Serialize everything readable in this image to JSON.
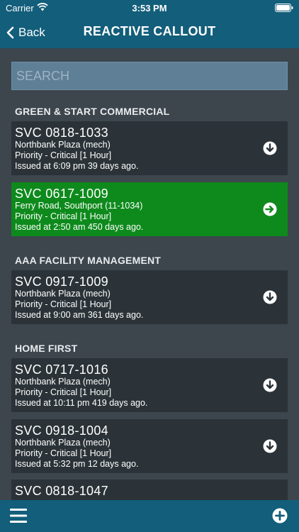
{
  "status_bar": {
    "carrier": "Carrier",
    "time": "3:53 PM"
  },
  "nav": {
    "back_label": "Back",
    "title": "REACTIVE CALLOUT"
  },
  "search": {
    "placeholder": "SEARCH",
    "value": ""
  },
  "sections": [
    {
      "name": "GREEN  & START COMMERCIAL",
      "items": [
        {
          "id": "SVC 0818-1033",
          "location": "Northbank Plaza (mech)",
          "priority": "Priority - Critical [1 Hour]",
          "issued": "Issued at 6:09 pm 39 days ago.",
          "state": "collapsed"
        },
        {
          "id": "SVC 0617-1009",
          "location": "Ferry Road, Southport (11-1034)",
          "priority": "Priority - Critical [1 Hour]",
          "issued": "Issued at 2:50 am 450 days ago.",
          "state": "selected"
        }
      ]
    },
    {
      "name": "AAA FACILITY MANAGEMENT",
      "items": [
        {
          "id": "SVC 0917-1009",
          "location": "Northbank Plaza (mech)",
          "priority": "Priority - Critical [1 Hour]",
          "issued": "Issued at 9:00 am 361 days ago.",
          "state": "collapsed"
        }
      ]
    },
    {
      "name": "HOME FIRST",
      "items": [
        {
          "id": "SVC 0717-1016",
          "location": "Northbank Plaza (mech)",
          "priority": "Priority - Critical [1 Hour]",
          "issued": "Issued at 10:11 pm 419 days ago.",
          "state": "collapsed"
        },
        {
          "id": "SVC 0918-1004",
          "location": "Northbank Plaza (mech)",
          "priority": "Priority - Critical [1 Hour]",
          "issued": "Issued at 5:32 pm 12 days ago.",
          "state": "collapsed"
        },
        {
          "id": "SVC 0818-1047",
          "state": "partial"
        }
      ]
    }
  ],
  "icons": {
    "expand": "arrow-down-circle-icon",
    "open": "arrow-right-circle-icon",
    "menu": "hamburger-menu-icon",
    "add": "plus-circle-icon"
  },
  "colors": {
    "header_bg": "#135e7a",
    "page_bg": "#3d464d",
    "card_bg": "#2b3338",
    "selected_bg": "#0e8a1c",
    "search_bg": "#5e7f96"
  }
}
